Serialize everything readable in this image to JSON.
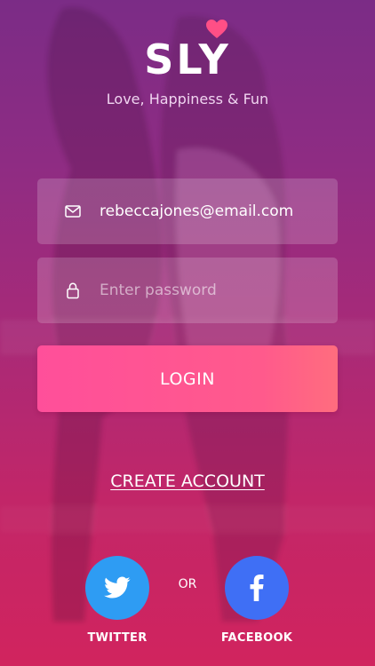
{
  "brand": {
    "name": "SLY",
    "tagline": "Love, Happiness & Fun",
    "heart_color": "#ff4f86"
  },
  "login_form": {
    "email": {
      "icon": "mail-icon",
      "value": "rebeccajones@email.com"
    },
    "password": {
      "icon": "lock-icon",
      "placeholder": "Enter password",
      "value": ""
    },
    "login_label": "LOGIN",
    "create_account_label": "CREATE ACCOUNT"
  },
  "social": {
    "or_label": "OR",
    "twitter": {
      "label": "TWITTER",
      "icon": "twitter-bird-icon",
      "color": "#2e9cf3"
    },
    "facebook": {
      "label": "FACEBOOK",
      "icon": "facebook-f-icon",
      "color": "#3f6ff5"
    }
  },
  "colors": {
    "gradient_top": "#7b2c86",
    "gradient_bottom": "#d1245e",
    "login_button": "#ff5591"
  }
}
